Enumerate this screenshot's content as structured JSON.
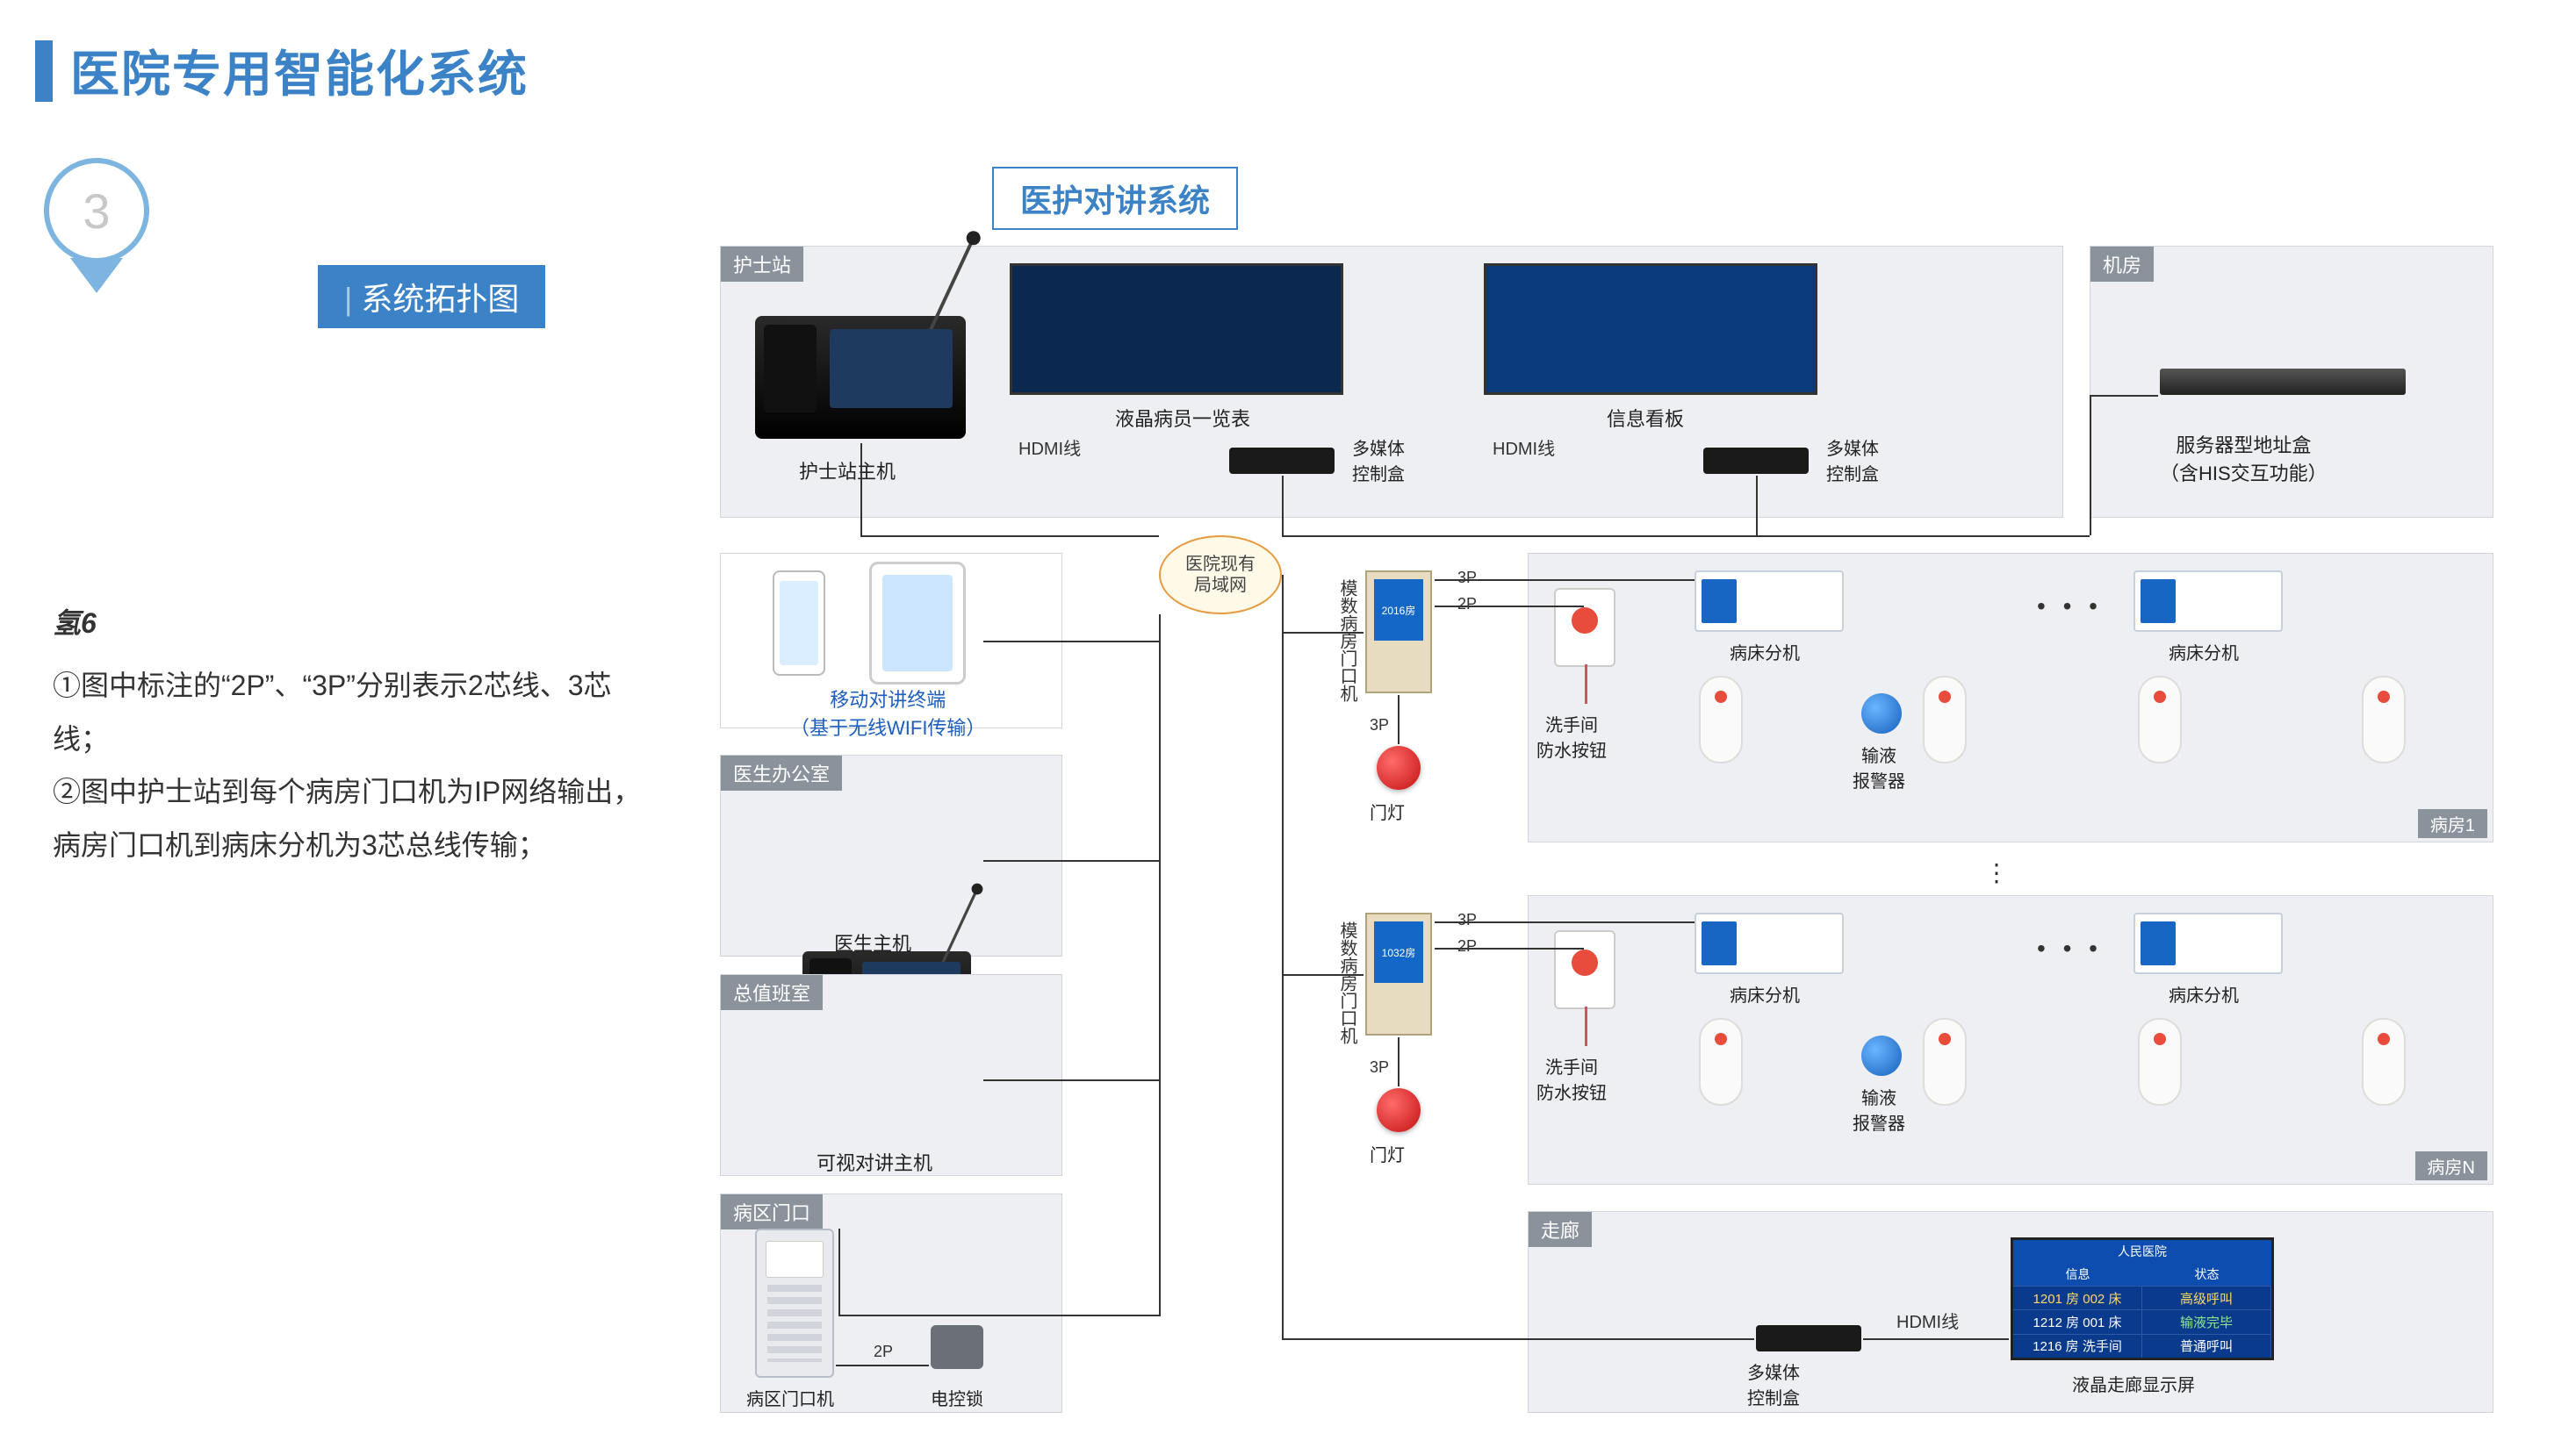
{
  "title": "医院专用智能化系统",
  "badge_number": "3",
  "subtitle": "系统拓扑图",
  "system_label": "医护对讲系统",
  "notes": {
    "header": "氢6",
    "line1": "①图中标注的“2P”、“3P”分别表示2芯线、3芯线；",
    "line2": "②图中护士站到每个病房门口机为IP网络输出，病房门口机到病床分机为3芯总线传输；"
  },
  "hub": {
    "l1": "医院现有",
    "l2": "局域网"
  },
  "zones": {
    "nurse": "护士站",
    "server_room": "机房",
    "doctor": "医生办公室",
    "duty": "总值班室",
    "ward_gate": "病区门口",
    "corridor": "走廊",
    "room1": "病房1",
    "roomN": "病房N"
  },
  "devices": {
    "nurse_host": "护士站主机",
    "lcd_patient": "液晶病员一览表",
    "info_board": "信息看板",
    "media_box": "多媒体\n控制盒",
    "server_box": "服务器型地址盒\n（含HIS交互功能）",
    "mobile_terminal": "移动对讲终端\n（基于无线WIFI传输）",
    "doctor_host": "医生主机",
    "duty_host": "可视对讲主机",
    "ward_door": "病区门口机",
    "elock": "电控锁",
    "room_door": "模数病房门口机",
    "door_lamp": "门灯",
    "wc_btn": "洗手间\n防水按钮",
    "bed_ext": "病床分机",
    "iv_alarm": "输液\n报警器",
    "corridor_scr": "液晶走廊显示屏"
  },
  "link_labels": {
    "hdmi": "HDMI线",
    "p2": "2P",
    "p3": "3P"
  },
  "room_numbers": {
    "r1": "2016房",
    "r2": "1032房"
  },
  "corridor_screen": {
    "title": "人民医院",
    "cols": [
      "信息",
      "状态"
    ],
    "rows": [
      [
        "1201 房 002 床",
        "高级呼叫"
      ],
      [
        "1212 房 001 床",
        "输液完毕"
      ],
      [
        "1216 房 洗手间",
        "普通呼叫"
      ]
    ]
  }
}
